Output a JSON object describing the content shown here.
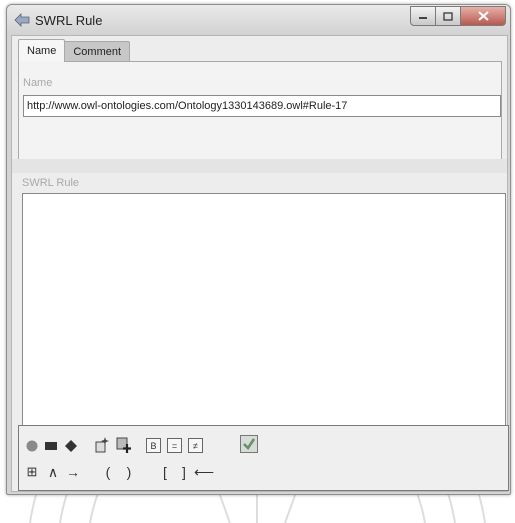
{
  "window": {
    "title": "SWRL Rule",
    "icon": "swrl-tool-icon"
  },
  "tabs": [
    {
      "label": "Name",
      "active": true
    },
    {
      "label": "Comment",
      "active": false
    }
  ],
  "name_section": {
    "label": "Name",
    "value": "http://www.owl-ontologies.com/Ontology1330143689.owl#Rule-17"
  },
  "rule_section": {
    "label": "SWRL Rule",
    "value": ""
  },
  "toolbar": {
    "row1": [
      {
        "name": "insert-class-icon",
        "glyph": "●"
      },
      {
        "name": "insert-property-icon",
        "glyph": "▬"
      },
      {
        "name": "insert-individual-icon",
        "glyph": "◆"
      },
      {
        "name": "insert-builtin-icon",
        "glyph": "✦"
      },
      {
        "name": "insert-expression-icon",
        "glyph": "✚"
      },
      {
        "name": "boolean-button",
        "glyph": "B"
      },
      {
        "name": "equal-button",
        "glyph": "="
      },
      {
        "name": "not-equal-button",
        "glyph": "≠"
      },
      {
        "name": "validate-icon",
        "glyph": "✓"
      }
    ],
    "row2": [
      {
        "name": "grid-symbol-icon",
        "glyph": "⊞"
      },
      {
        "name": "and-symbol-button",
        "glyph": "∧"
      },
      {
        "name": "implies-symbol-button",
        "glyph": "→"
      },
      {
        "name": "open-paren-button",
        "glyph": "("
      },
      {
        "name": "close-paren-button",
        "glyph": ")"
      },
      {
        "name": "open-bracket-button",
        "glyph": "["
      },
      {
        "name": "close-bracket-button",
        "glyph": "]"
      },
      {
        "name": "backspace-button",
        "glyph": "⟵"
      }
    ]
  },
  "colors": {
    "window_bg": "#d4d4d4",
    "close_button": "#b65a50",
    "label_text": "#a9a9a9",
    "validate_green": "#8fb08f"
  }
}
